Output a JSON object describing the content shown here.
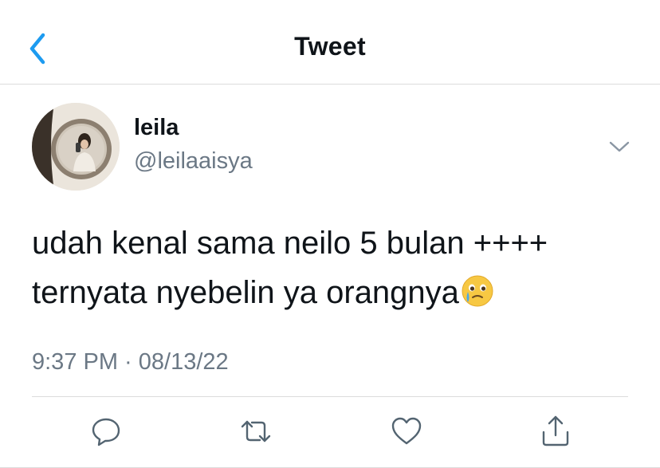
{
  "header": {
    "title": "Tweet",
    "back_icon": "chevron-left-icon"
  },
  "author": {
    "display_name": "leila",
    "handle": "@leilaaisya"
  },
  "tweet": {
    "text_line1": "udah kenal sama neilo 5 bulan ++++",
    "text_line2": "ternyata nyebelin ya orangnya",
    "emoji": "face-holding-back-tears",
    "timestamp": "9:37 PM · 08/13/22"
  },
  "actions": [
    "reply-icon",
    "retweet-icon",
    "like-icon",
    "share-icon"
  ],
  "colors": {
    "accent": "#1d9bf0",
    "text": "#0f1419",
    "secondary_text": "#6b7885",
    "divider": "#dcdcdc",
    "icon": "#536471"
  }
}
